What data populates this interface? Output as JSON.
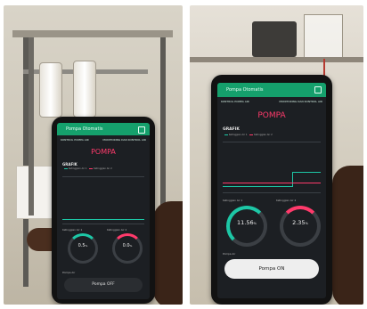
{
  "left_phone": {
    "app_title": "Pompa Otomatis",
    "subheader": {
      "left": "KONTROL POMPA AIR",
      "right": "MONITORING DAN KONTROL AIR"
    },
    "page_title": "POMPA",
    "chart_title": "GRAFIK",
    "legend": [
      "Ketinggian Air 1",
      "Ketinggian Air 2"
    ],
    "gauge_label_1": "Ketinggian Air 1",
    "gauge_label_2": "Ketinggian Air 2",
    "gauge_1": "0.5",
    "gauge_1_unit": "%",
    "gauge_2": "0.0",
    "gauge_2_unit": "%",
    "button_label": "Pompa OFF",
    "button_heading": "Pompa Air"
  },
  "right_phone": {
    "app_title": "Pompa Otomatis",
    "subheader": {
      "left": "KONTROL POMPA AIR",
      "right": "MONITORING DAN KONTROL AIR"
    },
    "page_title": "POMPA",
    "chart_title": "GRAFIK",
    "legend": [
      "Ketinggian Air 1",
      "Ketinggian Air 2"
    ],
    "gauge_label_1": "Ketinggian Air 1",
    "gauge_label_2": "Ketinggian Air 2",
    "gauge_1": "11.56",
    "gauge_1_unit": "%",
    "gauge_2": "2.35",
    "gauge_2_unit": "%",
    "button_label": "Pompa ON",
    "button_heading": "Pompa Air"
  },
  "colors": {
    "app_bar": "#15a06c",
    "title_red": "#ff3a6b",
    "gauge_teal": "#1dc7a6",
    "gauge_red": "#ff3a6b"
  }
}
